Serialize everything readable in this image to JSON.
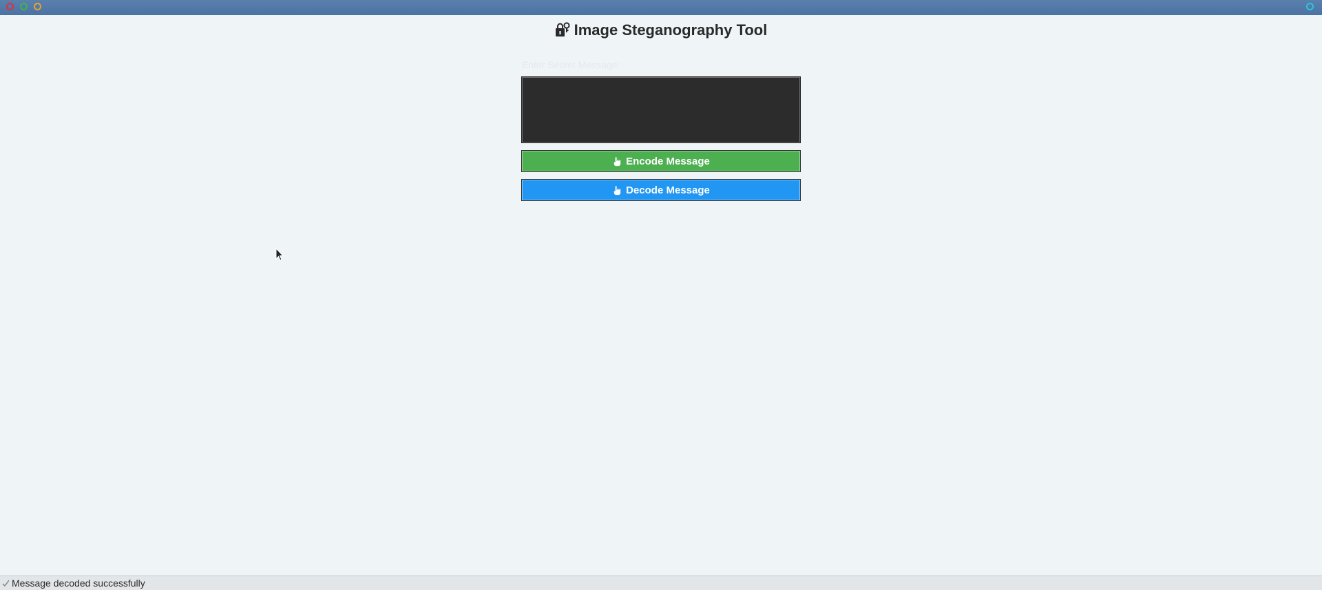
{
  "window": {
    "title_bar_buttons": [
      "close",
      "minimize",
      "maximize"
    ]
  },
  "app": {
    "title": "Image Steganography Tool",
    "title_icon": "lock-key-icon"
  },
  "form": {
    "message_label": "Enter Secret Message:",
    "message_value": ""
  },
  "buttons": {
    "encode_label": "Encode Message",
    "decode_label": "Decode Message",
    "encode_color": "#4caf50",
    "decode_color": "#2196f3",
    "icon": "hand-pointer-icon"
  },
  "status": {
    "text": "Message decoded successfully",
    "icon": "checkmark-icon"
  }
}
